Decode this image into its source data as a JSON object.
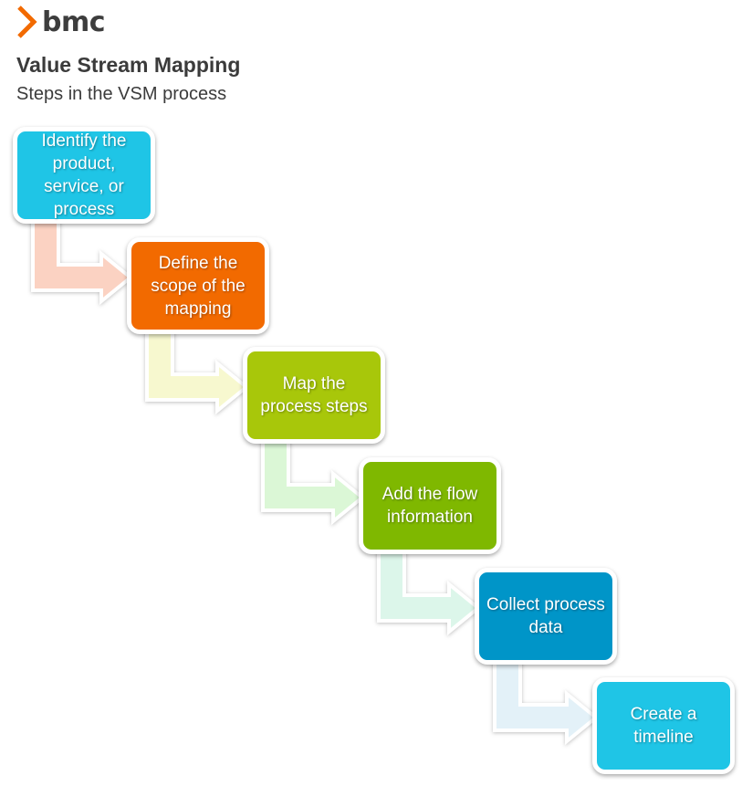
{
  "logo": {
    "text": "bmc",
    "icon": "bmc-logo-icon",
    "color": "#f26a00"
  },
  "header": {
    "title": "Value Stream Mapping",
    "subtitle": "Steps in the VSM process"
  },
  "steps": [
    {
      "label": "Identify the product, service, or process",
      "color": "#1fc5e6",
      "arrow_color": "#fbd2c2"
    },
    {
      "label": "Define the scope of the mapping",
      "color": "#f26a00",
      "arrow_color": "#f7f8cf"
    },
    {
      "label": "Map the process steps",
      "color": "#a8c70a",
      "arrow_color": "#dbf7d6"
    },
    {
      "label": "Add the flow information",
      "color": "#7fb800",
      "arrow_color": "#dcf6ea"
    },
    {
      "label": "Collect process data",
      "color": "#0095c8",
      "arrow_color": "#e3f1f8"
    },
    {
      "label": "Create a timeline",
      "color": "#1fc5e6"
    }
  ]
}
